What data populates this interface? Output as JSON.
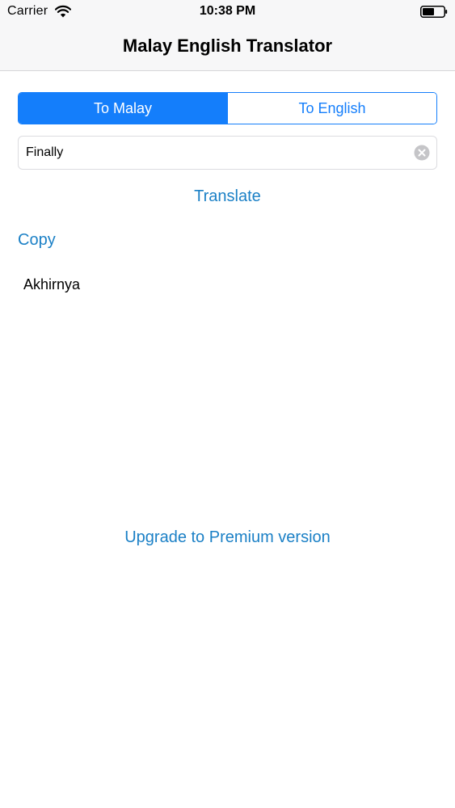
{
  "status_bar": {
    "carrier": "Carrier",
    "time": "10:38 PM",
    "wifi_icon": "wifi-icon",
    "battery_icon": "battery-icon"
  },
  "nav": {
    "title": "Malay English Translator"
  },
  "segmented_control": {
    "options": [
      {
        "label": "To Malay",
        "selected": true
      },
      {
        "label": "To English",
        "selected": false
      }
    ]
  },
  "input": {
    "value": "Finally",
    "clear_icon": "clear-icon"
  },
  "actions": {
    "translate_label": "Translate",
    "copy_label": "Copy",
    "upgrade_label": "Upgrade to Premium version"
  },
  "result": {
    "text": "Akhirnya"
  },
  "colors": {
    "accent": "#147efb",
    "link": "#1b80c6",
    "bar_background": "#f7f7f8"
  }
}
